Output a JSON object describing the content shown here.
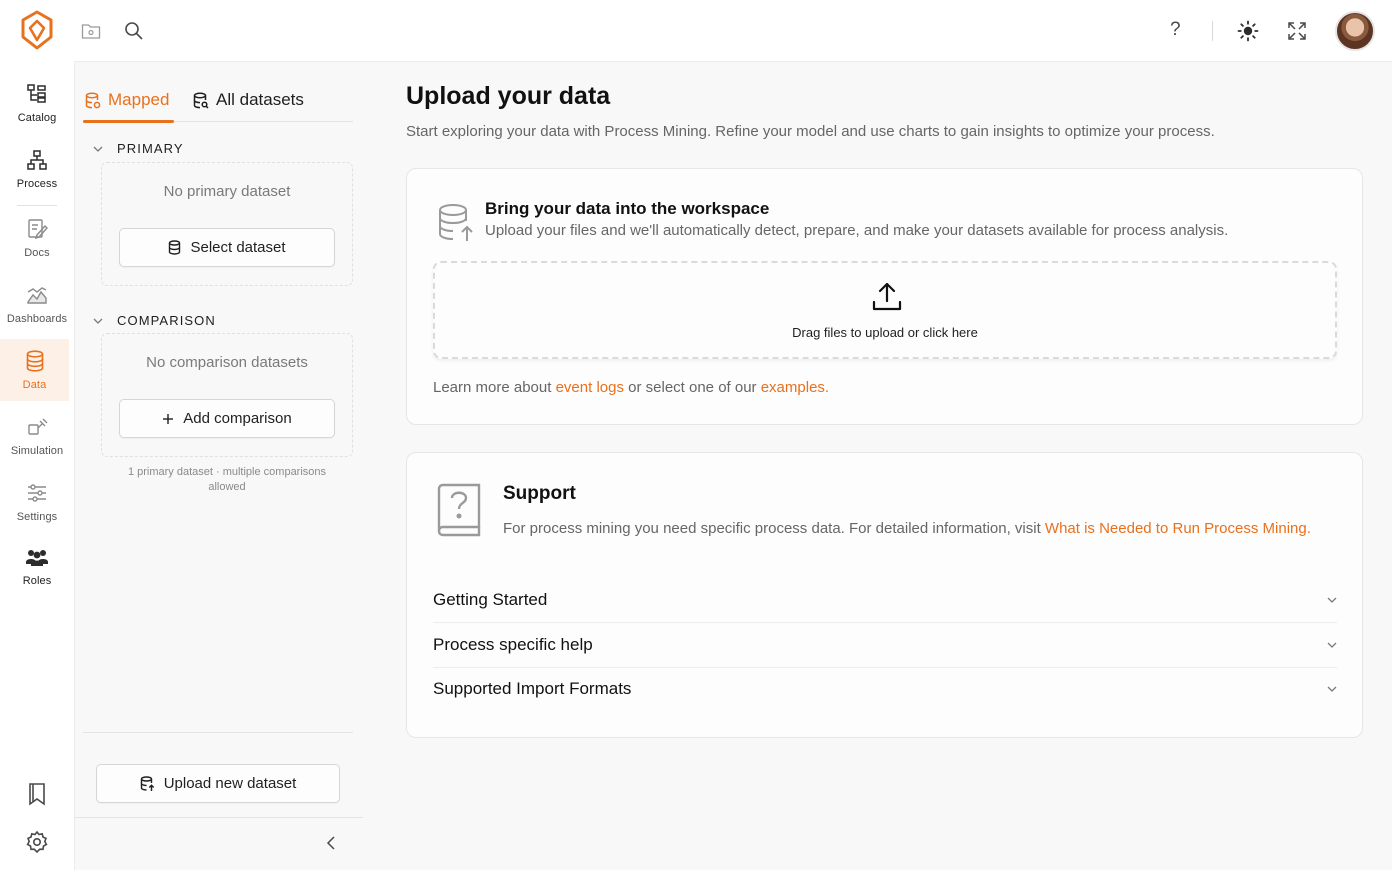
{
  "colors": {
    "accent": "#e8711e",
    "active_bg": "#fdf0e6",
    "text": "#1f1f1f",
    "muted": "#7a7a7a",
    "workspace_bg": "#f8f8f8"
  },
  "topbar": {
    "icons": [
      "logo-icon",
      "folder-icon",
      "search-icon",
      "help-icon",
      "theme-sun-icon",
      "fullscreen-icon",
      "avatar"
    ],
    "help_label": "?"
  },
  "nav": {
    "items": [
      {
        "label": "Catalog",
        "icon": "catalog-icon"
      },
      {
        "label": "Process",
        "icon": "process-icon"
      },
      {
        "label": "Docs",
        "icon": "docs-icon"
      },
      {
        "label": "Dashboards",
        "icon": "dashboards-icon"
      },
      {
        "label": "Data",
        "icon": "database-icon",
        "active": true
      },
      {
        "label": "Simulation",
        "icon": "simulation-icon"
      },
      {
        "label": "Settings",
        "icon": "sliders-icon"
      },
      {
        "label": "Roles",
        "icon": "roles-icon"
      }
    ],
    "bottom_icons": [
      "bookmark-icon",
      "gear-icon"
    ]
  },
  "panel": {
    "tabs": [
      {
        "label": "Mapped",
        "active": true
      },
      {
        "label": "All datasets"
      }
    ],
    "primary": {
      "heading": "PRIMARY",
      "empty": "No primary dataset",
      "button": "Select dataset"
    },
    "comparison": {
      "heading": "COMPARISON",
      "empty": "No comparison datasets",
      "button": "Add comparison"
    },
    "note": "1 primary dataset · multiple comparisons allowed",
    "upload_button": "Upload new dataset"
  },
  "main": {
    "title": "Upload your data",
    "subtitle": "Start exploring your data with Process Mining. Refine your model and use charts to gain insights to optimize your process.",
    "upload_card": {
      "title": "Bring your data into the workspace",
      "text": "Upload your files and we'll automatically detect, prepare, and make your datasets available for process analysis.",
      "dropzone": "Drag files to upload or click here",
      "learn_prefix": "Learn more about ",
      "learn_link1": "event logs",
      "learn_middle": " or select one of our ",
      "learn_link2": "examples",
      "learn_suffix": "."
    },
    "support_card": {
      "title": "Support",
      "text_prefix": "For process mining you need specific process data. For detailed information, visit ",
      "text_link": "What is Needed to Run Process Mining.",
      "accordion": [
        "Getting Started",
        "Process specific help",
        "Supported Import Formats"
      ]
    }
  }
}
